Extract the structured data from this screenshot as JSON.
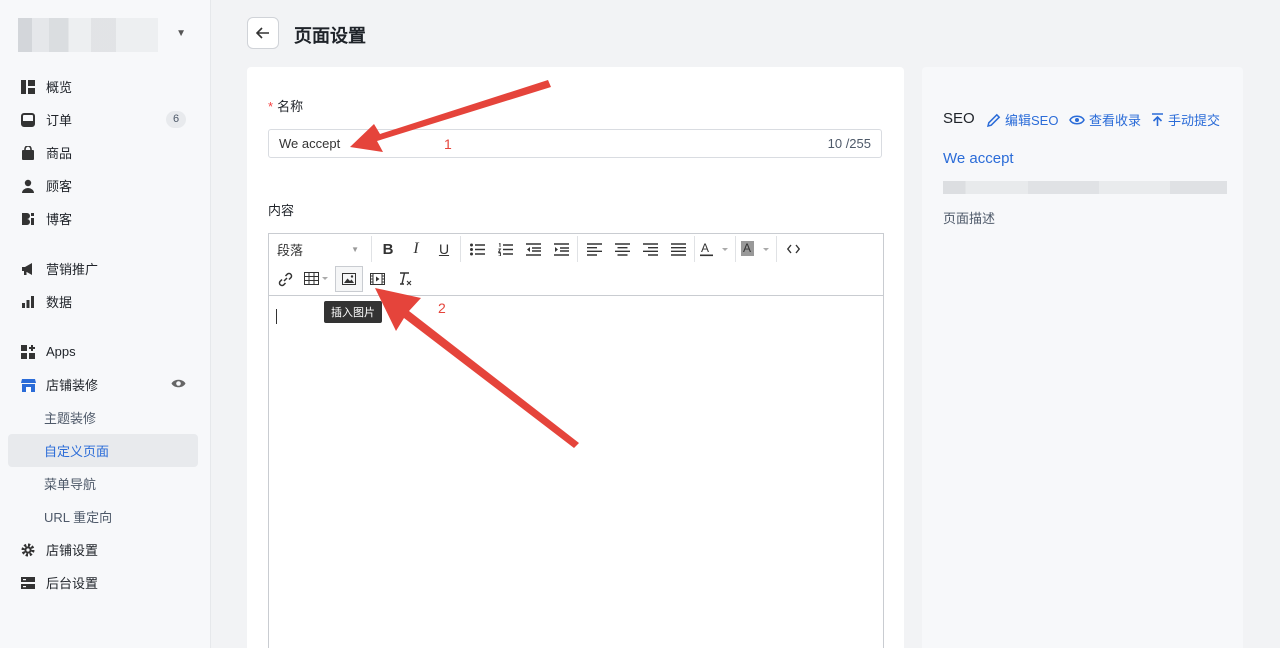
{
  "sidebar": {
    "items": [
      {
        "label": "概览",
        "icon": "dashboard-icon"
      },
      {
        "label": "订单",
        "icon": "inbox-icon",
        "badge": "6"
      },
      {
        "label": "商品",
        "icon": "bag-icon"
      },
      {
        "label": "顾客",
        "icon": "person-icon"
      },
      {
        "label": "博客",
        "icon": "blog-icon"
      },
      {
        "label": "营销推广",
        "icon": "megaphone-icon"
      },
      {
        "label": "数据",
        "icon": "bar-chart-icon"
      },
      {
        "label": "Apps",
        "icon": "apps-icon"
      },
      {
        "label": "店铺装修",
        "icon": "store-icon"
      },
      {
        "label": "主题装修"
      },
      {
        "label": "自定义页面"
      },
      {
        "label": "菜单导航"
      },
      {
        "label": "URL 重定向"
      },
      {
        "label": "店铺设置",
        "icon": "gear-icon"
      },
      {
        "label": "后台设置",
        "icon": "server-icon"
      }
    ]
  },
  "header": {
    "title": "页面设置"
  },
  "form": {
    "name_label": "名称",
    "name_value": "We accept",
    "name_count": "10 /255",
    "content_label": "内容",
    "paragraph_select": "段落",
    "tooltip": "插入图片"
  },
  "seo": {
    "title": "SEO",
    "edit": "编辑SEO",
    "view": "查看收录",
    "submit": "手动提交",
    "page_title": "We accept",
    "description": "页面描述"
  },
  "annotations": {
    "num1": "1",
    "num2": "2"
  },
  "colors": {
    "accent": "#2b6cd8",
    "arrow": "#e5443b"
  }
}
